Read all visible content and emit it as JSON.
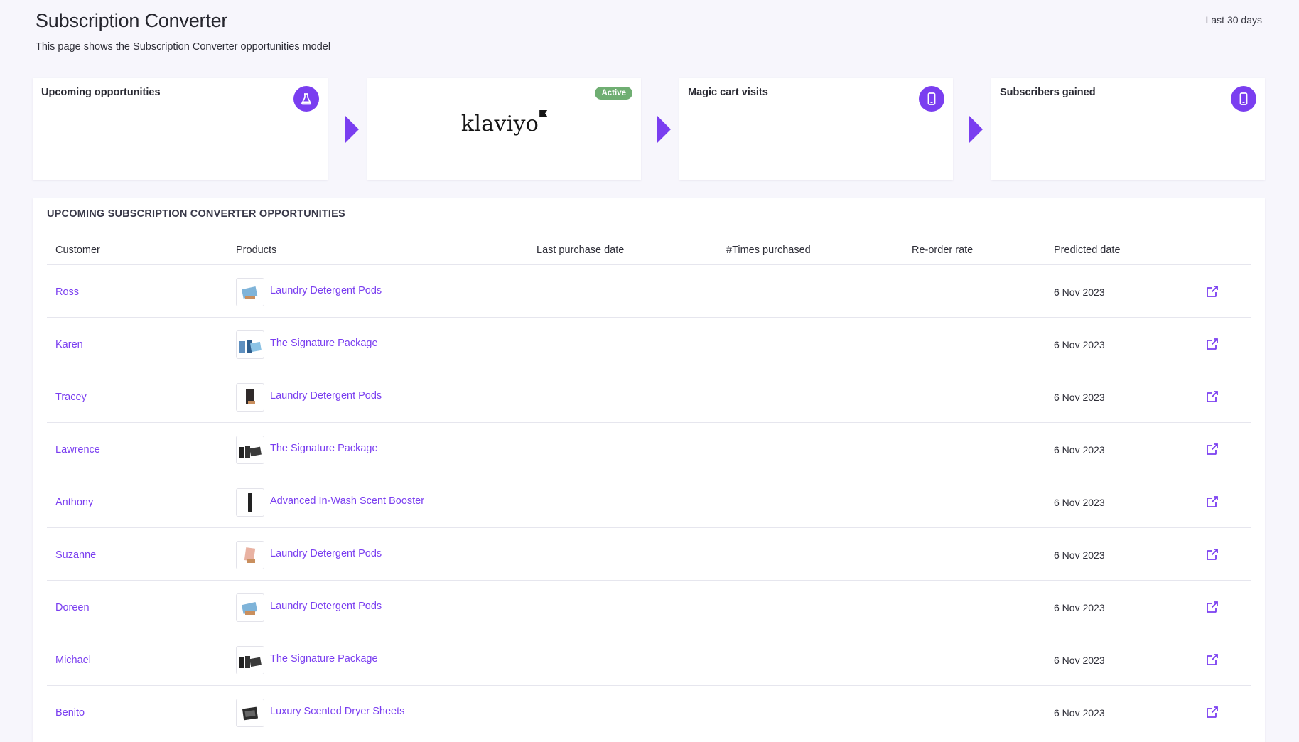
{
  "header": {
    "title": "Subscription Converter",
    "subtitle": "This page shows the Subscription Converter opportunities model",
    "date_range": "Last 30 days"
  },
  "colors": {
    "accent": "#7a3ef0",
    "active_badge": "#6fae72",
    "background": "#f7f6fc"
  },
  "flow": {
    "upcoming": {
      "title": "Upcoming opportunities",
      "icon": "flask-icon"
    },
    "integration": {
      "logo": "klaviyo",
      "status": "Active"
    },
    "magic_cart": {
      "title": "Magic cart visits",
      "icon": "mobile-icon"
    },
    "subscribers": {
      "title": "Subscribers gained",
      "icon": "mobile-icon"
    }
  },
  "table": {
    "title": "UPCOMING SUBSCRIPTION CONVERTER OPPORTUNITIES",
    "columns": [
      "Customer",
      "Products",
      "Last purchase date",
      "#Times purchased",
      "Re-order rate",
      "Predicted date"
    ],
    "rows": [
      {
        "customer": "Ross",
        "product": "Laundry Detergent Pods",
        "thumb": "blue-box",
        "predicted": "6 Nov 2023"
      },
      {
        "customer": "Karen",
        "product": "The Signature Package",
        "thumb": "blue-set",
        "predicted": "6 Nov 2023"
      },
      {
        "customer": "Tracey",
        "product": "Laundry Detergent Pods",
        "thumb": "dark-box",
        "predicted": "6 Nov 2023"
      },
      {
        "customer": "Lawrence",
        "product": "The Signature Package",
        "thumb": "dark-set",
        "predicted": "6 Nov 2023"
      },
      {
        "customer": "Anthony",
        "product": "Advanced In-Wash Scent Booster",
        "thumb": "bottle",
        "predicted": "6 Nov 2023"
      },
      {
        "customer": "Suzanne",
        "product": "Laundry Detergent Pods",
        "thumb": "pink-box",
        "predicted": "6 Nov 2023"
      },
      {
        "customer": "Doreen",
        "product": "Laundry Detergent Pods",
        "thumb": "blue-box",
        "predicted": "6 Nov 2023"
      },
      {
        "customer": "Michael",
        "product": "The Signature Package",
        "thumb": "dark-set",
        "predicted": "6 Nov 2023"
      },
      {
        "customer": "Benito",
        "product": "Luxury Scented Dryer Sheets",
        "thumb": "dark-sheets",
        "predicted": "6 Nov 2023"
      }
    ]
  }
}
